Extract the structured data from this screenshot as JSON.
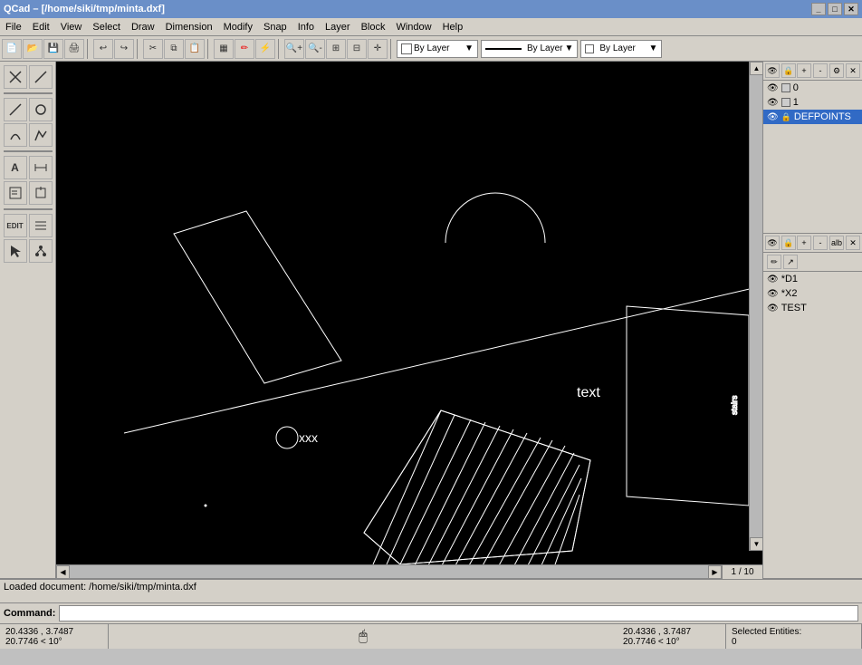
{
  "titlebar": {
    "title": "QCad – [/home/siki/tmp/minta.dxf]",
    "controls": [
      "_",
      "□",
      "✕"
    ]
  },
  "menubar": {
    "items": [
      "File",
      "Edit",
      "View",
      "Select",
      "Draw",
      "Dimension",
      "Modify",
      "Snap",
      "Info",
      "Layer",
      "Block",
      "Window",
      "Help"
    ]
  },
  "toolbar1": {
    "buttons": [
      "📄",
      "📂",
      "💾",
      "🖨",
      "",
      "↩",
      "↪",
      "✂",
      "📋",
      "📋",
      "",
      "▦",
      "✏",
      "⚡",
      "🔍",
      "🔍",
      "🔍",
      "🔍",
      "⊕",
      "✛"
    ],
    "dropdowns": {
      "color": "By Layer",
      "linetype": "By Layer",
      "linewidth": "By Layer"
    }
  },
  "layers": {
    "header_icons": [
      "eye",
      "lock",
      "plus",
      "minus",
      "settings",
      "close"
    ],
    "items": [
      {
        "name": "0",
        "visible": true,
        "locked": false,
        "color": "#ffffff",
        "selected": false
      },
      {
        "name": "1",
        "visible": true,
        "locked": false,
        "color": "#ffffff",
        "selected": false
      },
      {
        "name": "DEFPOINTS",
        "visible": true,
        "locked": true,
        "color": "#0000ff",
        "selected": true
      }
    ]
  },
  "blocks": {
    "header_icons": [
      "eye",
      "lock",
      "plus",
      "minus",
      "settings",
      "close",
      "pencil",
      "hand"
    ],
    "items": [
      {
        "name": "*D1",
        "visible": true
      },
      {
        "name": "*X2",
        "visible": true
      },
      {
        "name": "TEST",
        "visible": true
      }
    ]
  },
  "canvas": {
    "background": "#000000"
  },
  "scrollbar": {
    "page": "1 / 10"
  },
  "command": {
    "log": "Loaded document: /home/siki/tmp/minta.dxf",
    "label": "Command:",
    "input": ""
  },
  "statusbar": {
    "coord1_line1": "20.4336 , 3.7487",
    "coord1_line2": "20.7746 < 10°",
    "coord2_line1": "20.4336 , 3.7487",
    "coord2_line2": "20.7746 < 10°",
    "selected_label": "Selected Entities:",
    "selected_count": "0"
  }
}
